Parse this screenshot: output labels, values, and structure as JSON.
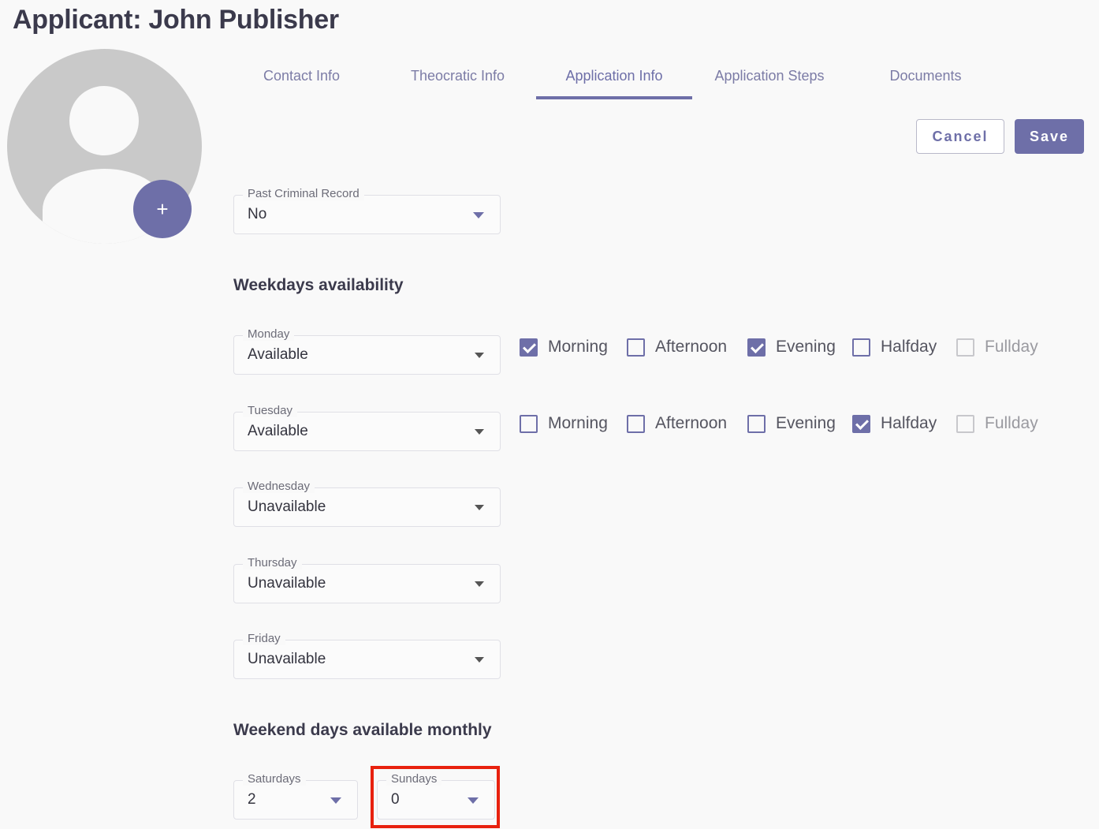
{
  "page": {
    "title": "Applicant: John Publisher"
  },
  "avatar": {
    "add_label": "+"
  },
  "tabs": [
    {
      "label": "Contact Info"
    },
    {
      "label": "Theocratic Info"
    },
    {
      "label": "Application Info",
      "active": true
    },
    {
      "label": "Application Steps"
    },
    {
      "label": "Documents"
    }
  ],
  "actions": {
    "cancel": "Cancel",
    "save": "Save"
  },
  "criminal_record": {
    "label": "Past Criminal Record",
    "value": "No"
  },
  "weekdays": {
    "heading": "Weekdays availability",
    "days": [
      {
        "label": "Monday",
        "value": "Available"
      },
      {
        "label": "Tuesday",
        "value": "Available"
      },
      {
        "label": "Wednesday",
        "value": "Unavailable"
      },
      {
        "label": "Thursday",
        "value": "Unavailable"
      },
      {
        "label": "Friday",
        "value": "Unavailable"
      }
    ],
    "options": {
      "morning": "Morning",
      "afternoon": "Afternoon",
      "evening": "Evening",
      "halfday": "Halfday",
      "fullday": "Fullday"
    },
    "monday_checks": {
      "morning": true,
      "afternoon": false,
      "evening": true,
      "halfday": false,
      "fullday": false
    },
    "tuesday_checks": {
      "morning": false,
      "afternoon": false,
      "evening": false,
      "halfday": true,
      "fullday": false
    }
  },
  "weekend": {
    "heading": "Weekend days available monthly",
    "saturdays": {
      "label": "Saturdays",
      "value": "2"
    },
    "sundays": {
      "label": "Sundays",
      "value": "0"
    }
  },
  "colors": {
    "accent": "#6e6fa8",
    "highlight": "#e8210e"
  }
}
